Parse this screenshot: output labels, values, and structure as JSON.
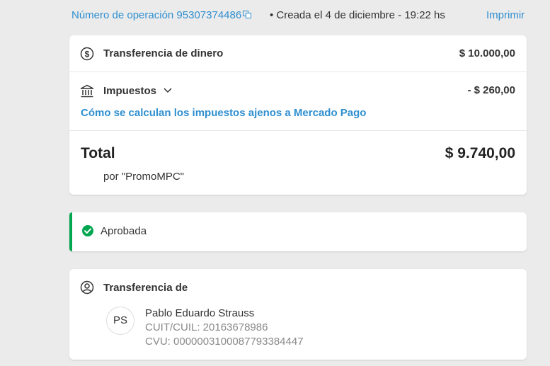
{
  "header": {
    "operation_link": "Número de operación 95307374486",
    "created": "• Creada el 4 de diciembre - 19:22 hs",
    "print_label": "Imprimir"
  },
  "summary": {
    "transfer_label": "Transferencia de dinero",
    "transfer_amount": "$ 10.000,00",
    "taxes_label": "Impuestos",
    "taxes_amount": "- $ 260,00",
    "taxes_link": "Cómo se calculan los impuestos ajenos a Mercado Pago",
    "total_label": "Total",
    "total_amount": "$ 9.740,00",
    "total_sub": "por \"PromoMPC\""
  },
  "status": {
    "label": "Aprobada",
    "color": "#00a650"
  },
  "transfer_from": {
    "title": "Transferencia de",
    "initials": "PS",
    "name": "Pablo Eduardo Strauss",
    "cuit": "CUIT/CUIL: 20163678986",
    "cvu": "CVU: 0000003100087793384447"
  },
  "colors": {
    "link": "#2f8fd0",
    "background": "#ebebeb",
    "approved": "#00a650"
  },
  "icons": [
    "copy-icon",
    "dollar-circle-icon",
    "bank-icon",
    "chevron-down-icon",
    "check-circle-icon",
    "user-circle-icon"
  ]
}
